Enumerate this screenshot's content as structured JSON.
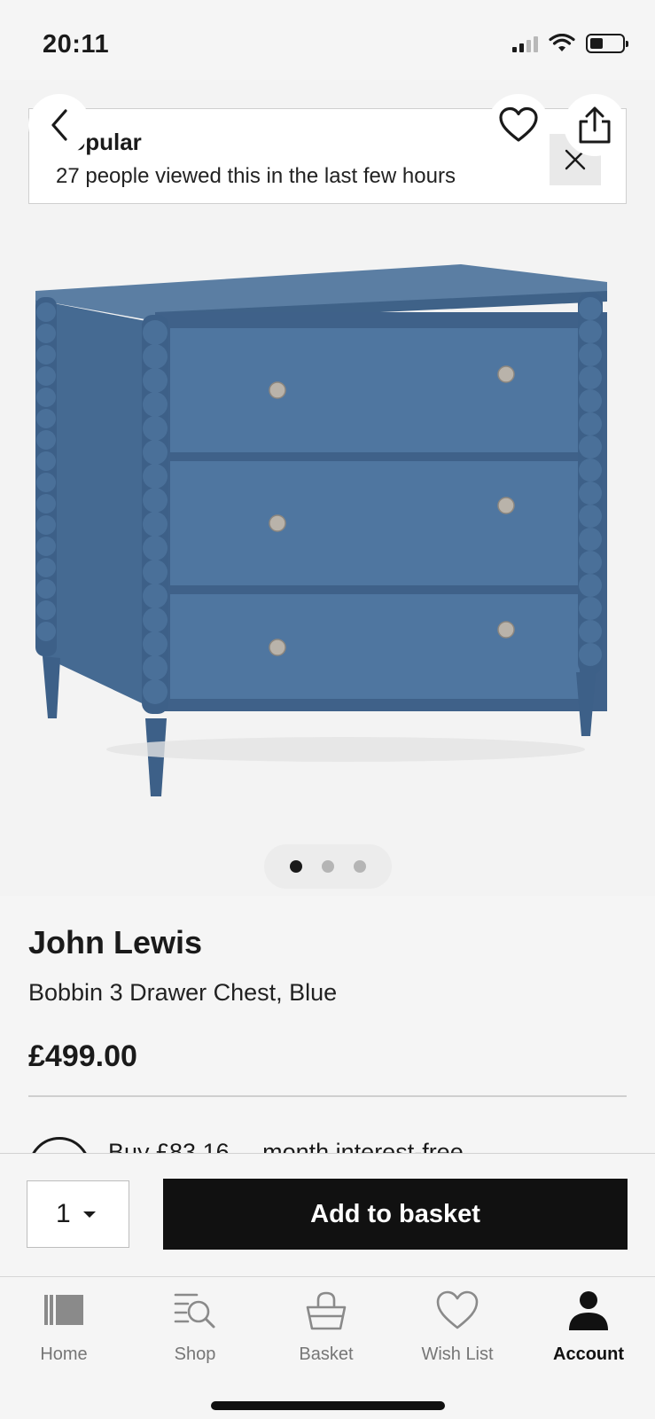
{
  "status_bar": {
    "time": "20:11",
    "icons": [
      "cellular-signal-icon",
      "wifi-icon",
      "battery-icon"
    ]
  },
  "hero": {
    "banner": {
      "title": "Popular",
      "text": "27 people viewed this in the last few hours",
      "close_icon": "close-icon"
    },
    "buttons": {
      "back_icon": "chevron-left-icon",
      "wishlist_icon": "heart-icon",
      "share_icon": "share-icon"
    },
    "image_dots": {
      "count": 3,
      "active": 1
    }
  },
  "product": {
    "brand": "John Lewis",
    "name": "Bobbin 3 Drawer Chest, Blue",
    "price": "£499.00",
    "promo_peek": "Buy £83.16 ... month interest-free"
  },
  "add_bar": {
    "quantity": "1",
    "add_label": "Add to basket"
  },
  "tab_bar": {
    "items": [
      {
        "label": "Home",
        "icon": "home-icon"
      },
      {
        "label": "Shop",
        "icon": "shop-search-icon"
      },
      {
        "label": "Basket",
        "icon": "basket-icon"
      },
      {
        "label": "Wish List",
        "icon": "heart-icon"
      },
      {
        "label": "Account",
        "icon": "account-icon"
      }
    ],
    "active": "Account"
  },
  "colors": {
    "accent": "#111111",
    "chest_blue": "#4b6f95",
    "background": "#f5f5f5"
  }
}
